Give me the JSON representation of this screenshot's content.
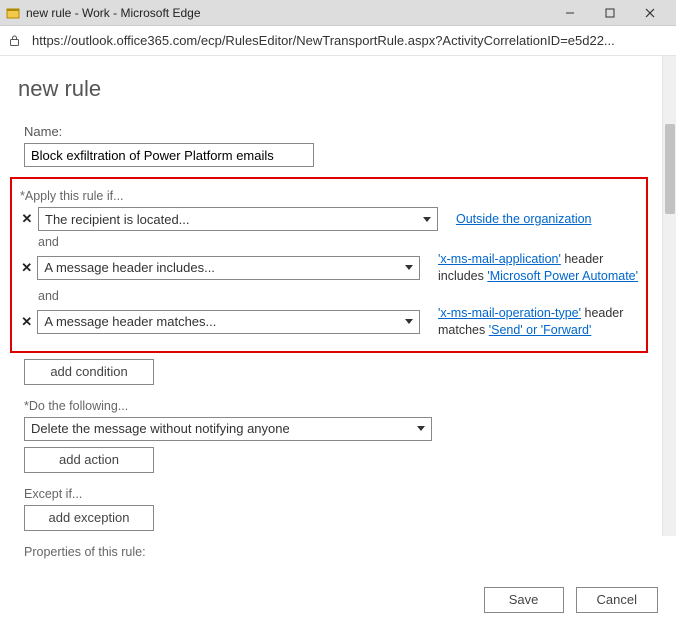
{
  "window": {
    "title": "new rule - Work - Microsoft Edge"
  },
  "address": {
    "url": "https://outlook.office365.com/ecp/RulesEditor/NewTransportRule.aspx?ActivityCorrelationID=e5d22..."
  },
  "page": {
    "title": "new rule"
  },
  "name": {
    "label": "Name:",
    "value": "Block exfiltration of Power Platform emails"
  },
  "apply": {
    "label": "*Apply this rule if...",
    "and": "and",
    "conditions": [
      {
        "text": "The recipient is located...",
        "side_html": "<a>Outside the organization</a>"
      },
      {
        "text": "A message header includes...",
        "side_html": "<a>'x-ms-mail-application'</a> header includes <a>'Microsoft Power Automate'</a>"
      },
      {
        "text": "A message header matches...",
        "side_html": "<a>'x-ms-mail-operation-type'</a> header matches <a>'Send' or 'Forward'</a>"
      }
    ],
    "add_condition": "add condition"
  },
  "do": {
    "label": "*Do the following...",
    "action": "Delete the message without notifying anyone",
    "add_action": "add action"
  },
  "except": {
    "label": "Except if...",
    "add_exception": "add exception"
  },
  "properties_label": "Properties of this rule:",
  "buttons": {
    "save": "Save",
    "cancel": "Cancel"
  }
}
